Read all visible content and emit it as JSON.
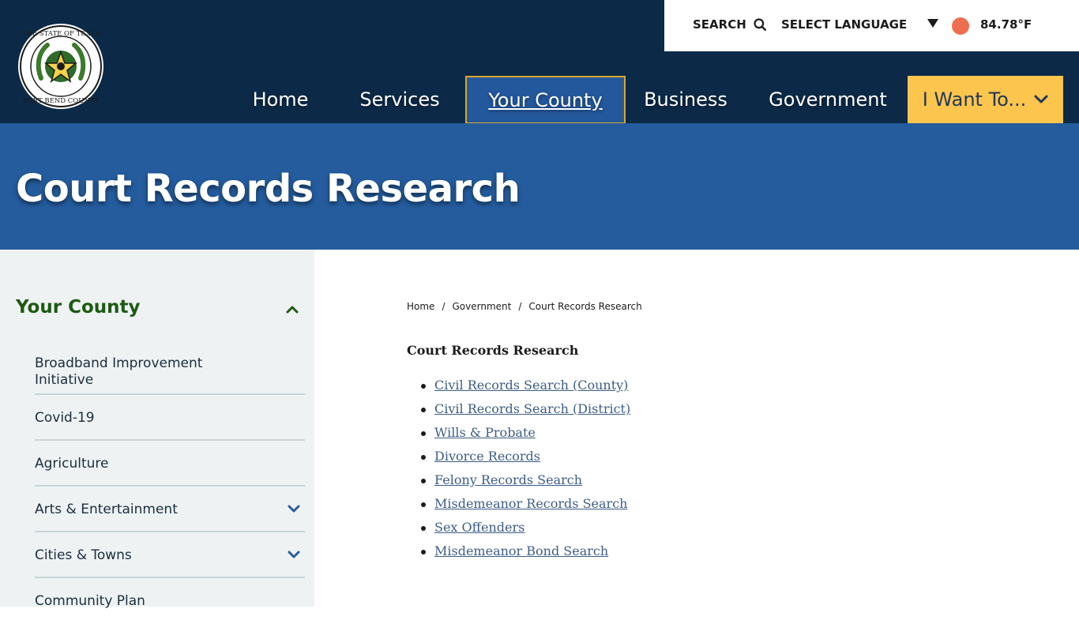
{
  "header": {
    "seal": {
      "top_text": "THE STATE OF TEXAS",
      "bottom_text": "FORT BEND COUNTY"
    },
    "utility": {
      "search_label": "SEARCH",
      "language_label": "SELECT LANGUAGE",
      "temperature": "84.78°F"
    },
    "nav": {
      "home": "Home",
      "services": "Services",
      "your_county": "Your County",
      "business": "Business",
      "government": "Government",
      "i_want_to": "I Want To..."
    }
  },
  "banner": {
    "title": "Court Records Research"
  },
  "sidebar": {
    "title": "Your County",
    "items": [
      {
        "label": "Broadband Improvement Initiative",
        "expandable": false
      },
      {
        "label": "Covid-19",
        "expandable": false
      },
      {
        "label": "Agriculture",
        "expandable": false
      },
      {
        "label": "Arts & Entertainment",
        "expandable": true
      },
      {
        "label": "Cities & Towns",
        "expandable": true
      },
      {
        "label": "Community Plan",
        "expandable": false
      }
    ]
  },
  "breadcrumb": {
    "items": [
      "Home",
      "Government",
      "Court Records Research"
    ],
    "separator": "/"
  },
  "content": {
    "title": "Court Records Research",
    "links": [
      "Civil Records Search (County)",
      "Civil Records Search (District)",
      "Wills & Probate",
      "Divorce Records",
      "Felony Records Search",
      "Misdemeanor Records Search",
      "Sex Offenders",
      "Misdemeanor Bond Search"
    ]
  },
  "colors": {
    "header_bg": "#0c2a48",
    "banner_bg": "#245c9e",
    "active_nav_bg": "#23589d",
    "active_nav_border": "#d9a82b",
    "cta_bg": "#fcc54d",
    "sidebar_bg": "#eef2f3",
    "sidebar_title": "#1d5a13",
    "link": "#3c5d86",
    "weather_icon": "#ee6e4f"
  },
  "icons": {
    "search": "search-icon",
    "language_dropdown": "caret-down-icon",
    "weather": "sun-icon",
    "cta": "chevron-down-icon",
    "sidebar_toggle": "chevron-up-icon",
    "sidebar_expand": "chevron-down-icon"
  }
}
